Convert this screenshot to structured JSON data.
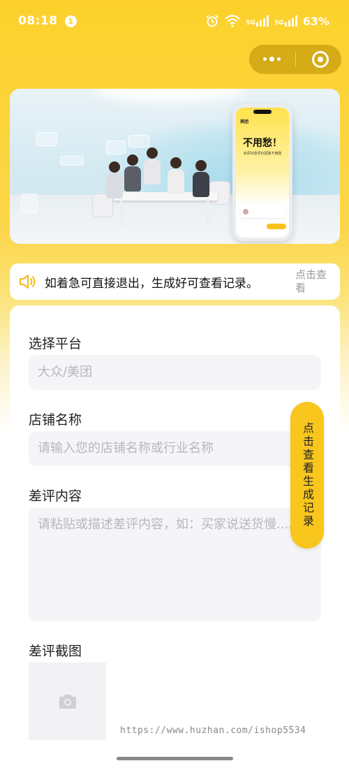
{
  "status_bar": {
    "time": "08:18",
    "notification_count": "1",
    "battery": "63%",
    "signal_labels": [
      "5G",
      "5G"
    ],
    "icons": [
      "alarm-icon",
      "wifi-icon",
      "signal-icon",
      "signal-icon"
    ]
  },
  "capsule": {
    "more_icon": "more-dots-icon",
    "close_icon": "target-icon"
  },
  "banner": {
    "phone_app_name": "美团",
    "phone_headline": "不用愁！",
    "phone_subtext": "点评抖音评价回复不用愁"
  },
  "notice": {
    "icon": "speaker-icon",
    "text": "如着急可直接退出，生成好可查看记录。",
    "link": "点击查看"
  },
  "form": {
    "platform_label": "选择平台",
    "platform_placeholder": "大众/美团",
    "shop_label": "店铺名称",
    "shop_placeholder": "请输入您的店铺名称或行业名称",
    "review_label": "差评内容",
    "review_placeholder": "请粘贴或描述差评内容，如：买家说送货慢......",
    "screenshot_label": "差评截图",
    "upload_icon": "camera-icon"
  },
  "side_button": {
    "label": "点击查看生成记录"
  },
  "watermark": "https://www.huzhan.com/ishop5534",
  "colors": {
    "accent": "#f8c61d",
    "background_top": "#fcd12b",
    "placeholder": "#b7b7bd"
  }
}
